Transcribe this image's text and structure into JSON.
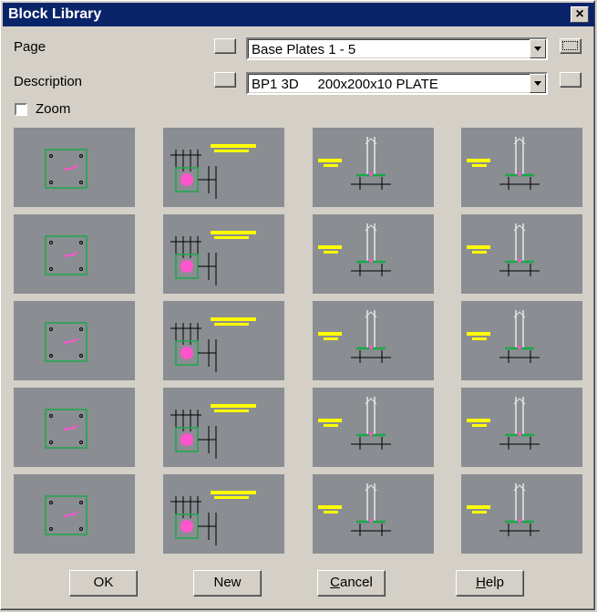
{
  "window": {
    "title": "Block Library",
    "close_glyph": "×"
  },
  "page": {
    "label": "Page",
    "value": "Base Plates 1 - 5"
  },
  "description": {
    "label": "Description",
    "value": "BP1 3D     200x200x10 PLATE"
  },
  "zoom": {
    "label": "Zoom",
    "checked": false
  },
  "thumbnail_style": {
    "background": "#8a8d91",
    "plate": "#1aa84a",
    "bolt": "#ff55cc",
    "text": "#ffff00",
    "line": "#000000"
  },
  "thumbnails": [
    {
      "kind": "plan"
    },
    {
      "kind": "section"
    },
    {
      "kind": "elev"
    },
    {
      "kind": "elev"
    },
    {
      "kind": "plan"
    },
    {
      "kind": "section"
    },
    {
      "kind": "elev"
    },
    {
      "kind": "elev"
    },
    {
      "kind": "plan"
    },
    {
      "kind": "section"
    },
    {
      "kind": "elev"
    },
    {
      "kind": "elev"
    },
    {
      "kind": "plan"
    },
    {
      "kind": "section"
    },
    {
      "kind": "elev"
    },
    {
      "kind": "elev"
    },
    {
      "kind": "plan"
    },
    {
      "kind": "section"
    },
    {
      "kind": "elev"
    },
    {
      "kind": "elev"
    }
  ],
  "buttons": {
    "ok": {
      "pre": "",
      "mnemonic": "",
      "post": "OK"
    },
    "new": {
      "pre": "",
      "mnemonic": "",
      "post": "New"
    },
    "cancel": {
      "pre": "",
      "mnemonic": "C",
      "post": "ancel"
    },
    "help": {
      "pre": "",
      "mnemonic": "H",
      "post": "elp"
    }
  }
}
